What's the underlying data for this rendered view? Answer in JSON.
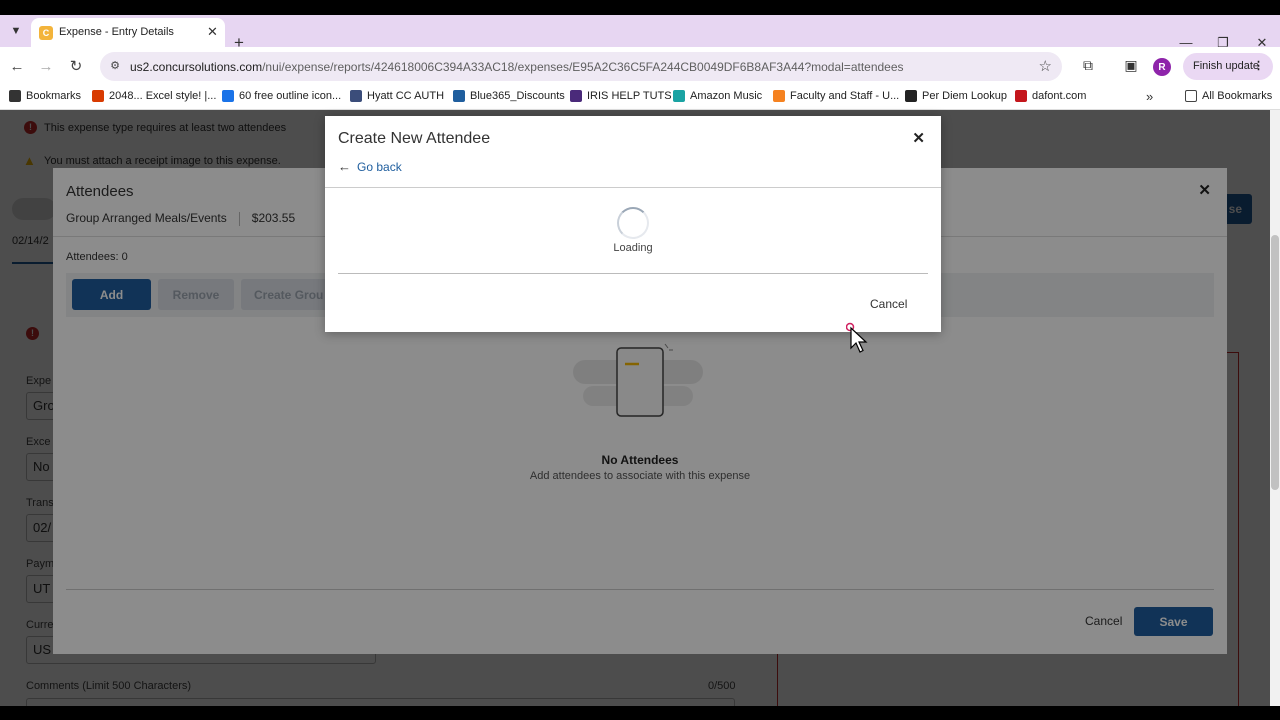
{
  "browser": {
    "tab_title": "Expense - Entry Details",
    "tab_favicon_letter": "C",
    "url_host": "us2.concursolutions.com",
    "url_path": "/nui/expense/reports/424618006C394A33AC18/expenses/E95A2C36C5FA244CB0049DF6B8AF3A44?modal=attendees",
    "profile_initial": "R",
    "finish_update_label": "Finish update"
  },
  "bookmarks": [
    {
      "label": "Bookmarks",
      "icon": "star-icon",
      "color": "#333333"
    },
    {
      "label": "2048... Excel style! |...",
      "icon": "office-icon",
      "color": "#d83b01"
    },
    {
      "label": "60 free outline icon...",
      "icon": "globe-icon",
      "color": "#1a73e8"
    },
    {
      "label": "Hyatt CC AUTH",
      "icon": "hyatt-icon",
      "color": "#3b4d7a"
    },
    {
      "label": "Blue365_Discounts",
      "icon": "blue365-icon",
      "color": "#1f5e9e"
    },
    {
      "label": "IRIS HELP TUTS",
      "icon": "play-icon",
      "color": "#4a2a7a"
    },
    {
      "label": "Amazon Music",
      "icon": "music-icon",
      "color": "#1aa3a3"
    },
    {
      "label": "Faculty and Staff - U...",
      "icon": "ut-icon",
      "color": "#f58220"
    },
    {
      "label": "Per Diem Lookup",
      "icon": "globe-dark-icon",
      "color": "#222222"
    },
    {
      "label": "dafont.com",
      "icon": "dafont-icon",
      "color": "#c4161c"
    }
  ],
  "all_bookmarks_label": "All Bookmarks",
  "page": {
    "alert_attendees": "This expense type requires at least two attendees",
    "alert_receipt": "You must attach a receipt image to this expense.",
    "date_fragment": "02/14/2",
    "field_labels": [
      "Expe",
      "Exce",
      "Trans",
      "Paym",
      "Curre"
    ],
    "field_values": [
      "Gro",
      "No",
      "02/",
      "UT",
      "US"
    ],
    "comments_label": "Comments (Limit 500 Characters)",
    "comments_count": "0/500",
    "right_btn_fragment": "se"
  },
  "attendees_modal": {
    "title": "Attendees",
    "expense_type": "Group Arranged Meals/Events",
    "amount": "$203.55",
    "count_label": "Attendees: 0",
    "add_label": "Add",
    "remove_label": "Remove",
    "create_group_label": "Create Grou",
    "empty_title": "No Attendees",
    "empty_subtitle": "Add attendees to associate with this expense",
    "cancel_label": "Cancel",
    "save_label": "Save"
  },
  "create_attendee": {
    "title": "Create New Attendee",
    "back_label": "Go back",
    "loading_label": "Loading",
    "cancel_label": "Cancel"
  },
  "colors": {
    "primary": "#1f5e9e",
    "error": "#c62828",
    "warning": "#f2b705",
    "tabstrip": "#e7d6f2"
  }
}
